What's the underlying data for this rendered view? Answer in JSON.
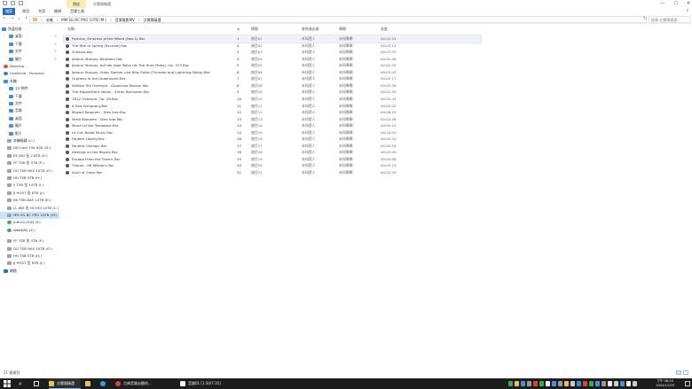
{
  "window": {
    "contextual_tab": "播放",
    "title": "交響樂精選",
    "controls": {
      "min": "—",
      "max": "☐",
      "close": "✕"
    }
  },
  "ribbon": {
    "tabs": [
      "檔案",
      "常用",
      "共用",
      "檢視",
      "音樂工具"
    ],
    "help": "?"
  },
  "address": {
    "back": "←",
    "forward": "→",
    "up_history": "⌄",
    "up": "↑",
    "crumbs": [
      "本機",
      "MM SG BC PRO 10TB (M:)",
      "音樂電影MV",
      "交響樂精選"
    ],
    "separator": "›",
    "search_placeholder": "搜尋 交響樂精選"
  },
  "sidebar": {
    "items": [
      {
        "label": "快速存取",
        "icon": "star-icon",
        "kind": "star"
      },
      {
        "label": "桌面",
        "icon": "desktop-icon",
        "kind": "blue",
        "pinned": true
      },
      {
        "label": "下載",
        "icon": "download-icon",
        "kind": "blue",
        "pinned": true
      },
      {
        "label": "文件",
        "icon": "document-icon",
        "kind": "blue",
        "pinned": true
      },
      {
        "label": "圖片",
        "icon": "picture-icon",
        "kind": "blue",
        "pinned": true
      },
      {
        "label": "Desktop",
        "icon": "desktop-folder-icon",
        "kind": "red"
      },
      {
        "label": "OneDrive - Personal",
        "icon": "onedrive-icon",
        "kind": "cloud"
      },
      {
        "label": "本機",
        "icon": "this-pc-icon",
        "kind": "pc"
      },
      {
        "label": "3D 物件",
        "icon": "3d-objects-icon",
        "kind": "blue"
      },
      {
        "label": "下載",
        "icon": "download-icon",
        "kind": "blue"
      },
      {
        "label": "文件",
        "icon": "document-icon",
        "kind": "blue"
      },
      {
        "label": "音樂",
        "icon": "music-icon",
        "kind": "blue"
      },
      {
        "label": "桌面",
        "icon": "desktop-icon",
        "kind": "blue"
      },
      {
        "label": "圖片",
        "icon": "picture-icon",
        "kind": "blue"
      },
      {
        "label": "影片",
        "icon": "video-icon",
        "kind": "blue"
      },
      {
        "label": "本機磁碟 (C:)",
        "icon": "drive-icon",
        "kind": "drive"
      },
      {
        "label": "DD Intel 730 SSD (D:)",
        "icon": "drive-icon",
        "kind": "drive"
      },
      {
        "label": "EE WD 金 2.8TB (E:)",
        "icon": "drive-icon",
        "kind": "drive"
      },
      {
        "label": "FF TSB 金 4TB (F:)",
        "icon": "drive-icon",
        "kind": "drive"
      },
      {
        "label": "GG TSB NAS 10TB (G:)",
        "icon": "drive-icon",
        "kind": "drive"
      },
      {
        "label": "HH TSB 5TB (H:)",
        "icon": "drive-icon",
        "kind": "drive"
      },
      {
        "label": "II TSB 金 14TB (I:)",
        "icon": "drive-icon",
        "kind": "drive"
      },
      {
        "label": "JJ HGST 金 8TB (J:)",
        "icon": "drive-icon",
        "kind": "drive"
      },
      {
        "label": "KK TSB NAS 14TB (K:)",
        "icon": "drive-icon",
        "kind": "drive"
      },
      {
        "label": "LL WD 金 HC530 14TB (L:)",
        "icon": "drive-icon",
        "kind": "drive"
      },
      {
        "label": "MM SG BC PRO 10TB (M:)",
        "icon": "drive-icon",
        "kind": "drive",
        "selected": true
      },
      {
        "label": "InfiniCLOUD (Y:)",
        "icon": "network-drive-icon",
        "kind": "green"
      },
      {
        "label": "WebDAV (Z:)",
        "icon": "network-drive-icon",
        "kind": "green"
      },
      {
        "label": "FF TSB 金 4TB (F:)",
        "icon": "drive-icon",
        "kind": "drive"
      },
      {
        "label": "GG TSB NAS 10TB (G:)",
        "icon": "drive-icon",
        "kind": "drive"
      },
      {
        "label": "HH TSB 5TB (H:)",
        "icon": "drive-icon",
        "kind": "drive"
      },
      {
        "label": "JJ HGST 金 8TB (J:)",
        "icon": "drive-icon",
        "kind": "drive"
      },
      {
        "label": "網路",
        "icon": "network-icon",
        "kind": "net"
      }
    ]
  },
  "columns": {
    "name": "名稱",
    "number": "#",
    "title": "標題",
    "artist": "參與演出者",
    "album": "專輯",
    "length": "長度"
  },
  "files": [
    {
      "name": "Fortune, Empress of the World (Nov.1).flac",
      "num": "1",
      "title": "曲目01",
      "artist": "未知藝人",
      "album": "未知專輯",
      "length": "00:02:33"
    },
    {
      "name": "The Rite of Spring (Excerpt).flac",
      "num": "2",
      "title": "曲目02",
      "artist": "未知藝人",
      "album": "未知專輯",
      "length": "00:03:14"
    },
    {
      "name": "Scherzo.flac",
      "num": "3",
      "title": "曲目03",
      "artist": "未知藝人",
      "album": "未知專輯",
      "length": "00:07:35"
    },
    {
      "name": "Johann Strauss, Banditen.flac",
      "num": "4",
      "title": "曲目04",
      "artist": "未知藝人",
      "album": "未知專輯",
      "length": "00:02:40"
    },
    {
      "name": "Johann Strauss, Auf der Jagd Polka (At The Hunt Polka), Op. 373.flac",
      "num": "5",
      "title": "曲目05",
      "artist": "未知藝人",
      "album": "未知專輯",
      "length": "00:02:33"
    },
    {
      "name": "Johann Strauss, Unter Donner und Blitz Polka (Thunder and Lightning Polka).flac",
      "num": "6",
      "title": "曲目06",
      "artist": "未知藝人",
      "album": "未知專輯",
      "length": "00:03:43"
    },
    {
      "name": "Orpheus in the Underworld.flac",
      "num": "7",
      "title": "曲目07",
      "artist": "未知藝人",
      "album": "未知專輯",
      "length": "00:02:17"
    },
    {
      "name": "William Tell Overture - Gioachino Rossini.flac",
      "num": "8",
      "title": "曲目08",
      "artist": "未知藝人",
      "album": "未知專輯",
      "length": "00:03:38"
    },
    {
      "name": "The Magnificent Seven - Elmer Bernstein.flac",
      "num": "9",
      "title": "曲目09",
      "artist": "未知藝人",
      "album": "未知專輯",
      "length": "00:05:30"
    },
    {
      "name": "1812 Overture, Op. 49.flac",
      "num": "10",
      "title": "曲目10",
      "artist": "未知藝人",
      "album": "未知專輯",
      "length": "00:03:43"
    },
    {
      "name": "A Sea Symphony.flac",
      "num": "11",
      "title": "曲目11",
      "artist": "未知藝人",
      "album": "未知專輯",
      "length": "00:03:22"
    },
    {
      "name": "Mozart Requiem - Dies Irae.flac",
      "num": "12",
      "title": "曲目12",
      "artist": "未知藝人",
      "album": "未知專輯",
      "length": "00:06:19"
    },
    {
      "name": "Verdi Requiem - Dies Irae.flac",
      "num": "13",
      "title": "曲目13",
      "artist": "未知藝人",
      "album": "未知專輯",
      "length": "00:02:26"
    },
    {
      "name": "March of the Toreadors.flac",
      "num": "14",
      "title": "曲目14",
      "artist": "未知藝人",
      "album": "未知專輯",
      "length": "00:02:15"
    },
    {
      "name": "Le Cid: Ballet Music.flac",
      "num": "15",
      "title": "曲目15",
      "artist": "未知藝人",
      "album": "未知專輯",
      "length": "00:10:03"
    },
    {
      "name": "Fanfare Liberty.flac",
      "num": "16",
      "title": "曲目16",
      "artist": "未知藝人",
      "album": "未知專輯",
      "length": "00:04:24"
    },
    {
      "name": "Fanfare Olympic.flac",
      "num": "17",
      "title": "曲目17",
      "artist": "未知藝人",
      "album": "未知專輯",
      "length": "00:04:18"
    },
    {
      "name": "Attempt on the Royals.flac",
      "num": "18",
      "title": "曲目18",
      "artist": "未知藝人",
      "album": "未知專輯",
      "length": "00:03:40"
    },
    {
      "name": "Escape From the Tavern.flac",
      "num": "19",
      "title": "曲目19",
      "artist": "未知藝人",
      "album": "未知專輯",
      "length": "00:05:08"
    },
    {
      "name": "Theme - 06 Willow's.flac",
      "num": "20",
      "title": "曲目20",
      "artist": "未知藝人",
      "album": "未知專輯",
      "length": "00:03:19"
    },
    {
      "name": "Anvil of Crom.flac",
      "num": "21",
      "title": "曲目21",
      "artist": "未知藝人",
      "album": "未知專輯",
      "length": "00:02:29"
    }
  ],
  "status": {
    "item_count": "21 個項目"
  },
  "taskbar": {
    "apps": [
      {
        "label": "交響樂精選",
        "color": "#e8c35a",
        "icon": "file-explorer-icon",
        "active": true
      },
      {
        "label": "古典音樂必聽的...",
        "color": "#dd4433",
        "icon": "chrome-icon",
        "active": false
      },
      {
        "label": "音樂01 [1:30/7:35]",
        "color": "#f0f0f0",
        "icon": "media-player-icon",
        "active": false
      }
    ],
    "search_icon": "⌕",
    "time": "下午 08:00",
    "date": "2024/12/29",
    "colors": {
      "bar": "#1d1d1d",
      "accent": "#7fb8ef",
      "selection": "#cce4f7"
    }
  }
}
